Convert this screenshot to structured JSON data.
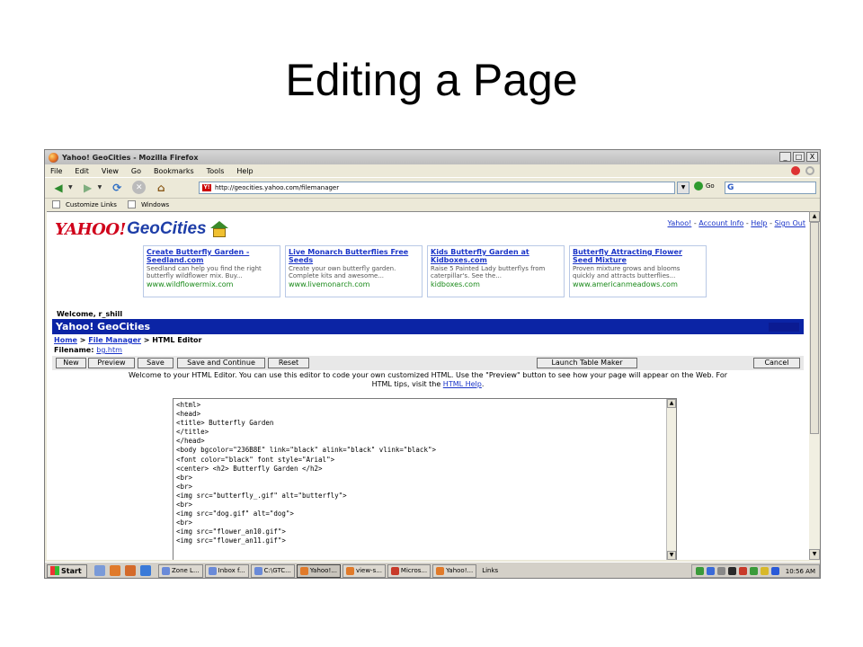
{
  "slide": {
    "title": "Editing a Page"
  },
  "window": {
    "title": "Yahoo! GeoCities - Mozilla Firefox",
    "buttons": {
      "minimize": "_",
      "maximize": "□",
      "close": "X"
    }
  },
  "menu": [
    "File",
    "Edit",
    "View",
    "Go",
    "Bookmarks",
    "Tools",
    "Help"
  ],
  "navbar": {
    "url": "http://geocities.yahoo.com/filemanager",
    "go_label": "Go",
    "search_glyph": "G"
  },
  "bookmarks": [
    "Customize Links",
    "Windows"
  ],
  "page": {
    "logo": {
      "yahoo": "YAHOO!",
      "geocities": "GeoCities"
    },
    "top_links": [
      "Yahoo!",
      "Account Info",
      "Help",
      "Sign Out"
    ],
    "ads": [
      {
        "title": "Create Butterfly Garden - Seedland.com",
        "desc": "Seedland can help you find the right butterfly wildflower mix. Buy...",
        "url": "www.wildflowermix.com"
      },
      {
        "title": "Live Monarch Butterflies Free Seeds",
        "desc": "Create your own butterfly garden. Complete kits and awesome...",
        "url": "www.livemonarch.com"
      },
      {
        "title": "Kids Butterfly Garden at Kidboxes.com",
        "desc": "Raise 5 Painted Lady butterflys from caterpillar's. See the...",
        "url": "kidboxes.com"
      },
      {
        "title": "Butterfly Attracting Flower Seed Mixture",
        "desc": "Proven mixture grows and blooms quickly and attracts butterflies...",
        "url": "www.americanmeadows.com"
      }
    ],
    "welcome": "Welcome, r_shill",
    "section_title": "Yahoo! GeoCities",
    "breadcrumb": {
      "home": "Home",
      "sep1": ">",
      "file_manager": "File Manager",
      "sep2": ">",
      "current": "HTML Editor"
    },
    "filename": {
      "label": "Filename:",
      "value": "bg.htm"
    },
    "buttons": {
      "new": "New",
      "preview": "Preview",
      "save": "Save",
      "save_continue": "Save and Continue",
      "reset": "Reset",
      "launch_table": "Launch Table Maker",
      "cancel": "Cancel"
    },
    "intro_line1": "Welcome to your HTML Editor. You can use this editor to code your own customized HTML. Use the \"Preview\" button to see how your page will appear on the Web. For",
    "intro_line2_pre": "HTML tips, visit the ",
    "intro_link": "HTML Help",
    "intro_line2_post": ".",
    "editor_code": "<html>\n<head>\n<title> Butterfly Garden\n</title>\n</head>\n<body bgcolor=\"236B8E\" link=\"black\" alink=\"black\" vlink=\"black\">\n<font color=\"black\" font style=\"Arial\">\n<center> <h2> Butterfly Garden </h2>\n<br>\n<br>\n<img src=\"butterfly_.gif\" alt=\"butterfly\">\n<br>\n<img src=\"dog.gif\" alt=\"dog\">\n<br>\n<img src=\"flower_an10.gif\">\n<img src=\"flower_an11.gif\">"
  },
  "taskbar": {
    "start": "Start",
    "tasks": [
      "Zone L...",
      "Inbox f...",
      "C:\\GTC...",
      "Yahoo!...",
      "view-s...",
      "Micros...",
      "Yahoo!..."
    ],
    "links_label": "Links",
    "clock": "10:56 AM"
  },
  "colors": {
    "geocities_bar": "#0b24a5",
    "link_blue": "#1a34c8",
    "ad_url_green": "#1a8a1a",
    "yahoo_red": "#d0021b"
  }
}
